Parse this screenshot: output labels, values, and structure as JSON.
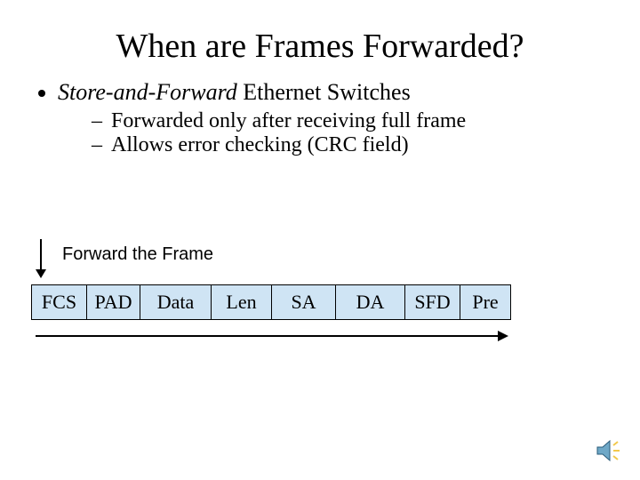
{
  "title": "When are Frames Forwarded?",
  "bullet": {
    "lead_italic": "Store-and-Forward",
    "lead_rest": " Ethernet Switches",
    "subs": [
      "Forwarded only after receiving full frame",
      "Allows error checking (CRC field)"
    ]
  },
  "diagram": {
    "forward_label": "Forward the Frame",
    "fields": [
      "FCS",
      "PAD",
      "Data",
      "Len",
      "SA",
      "DA",
      "SFD",
      "Pre"
    ]
  },
  "icons": {
    "speaker": "speaker-icon"
  }
}
